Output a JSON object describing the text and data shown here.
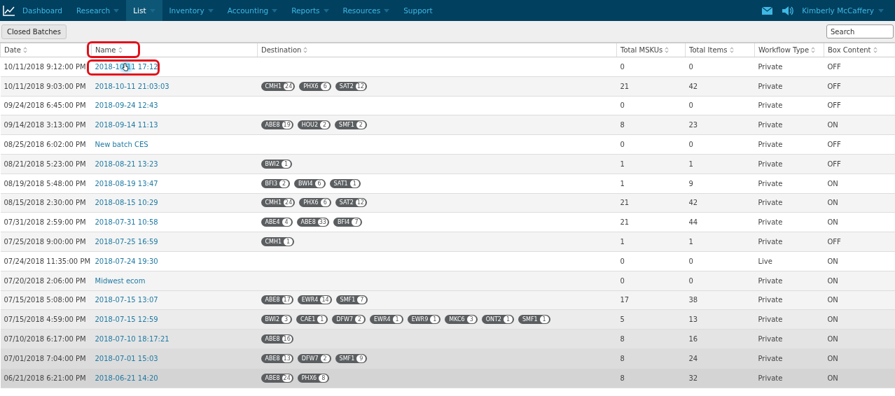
{
  "nav": {
    "items": [
      {
        "label": "Dashboard",
        "selected": false,
        "dropdown": false
      },
      {
        "label": "Research",
        "selected": false,
        "dropdown": true
      },
      {
        "label": "List",
        "selected": true,
        "dropdown": true
      },
      {
        "label": "Inventory",
        "selected": false,
        "dropdown": true
      },
      {
        "label": "Accounting",
        "selected": false,
        "dropdown": true
      },
      {
        "label": "Reports",
        "selected": false,
        "dropdown": true
      },
      {
        "label": "Resources",
        "selected": false,
        "dropdown": true
      },
      {
        "label": "Support",
        "selected": false,
        "dropdown": false
      }
    ],
    "user": "Kimberly McCaffery"
  },
  "toolbar": {
    "button": "Closed Batches",
    "search": {
      "placeholder": "Search"
    }
  },
  "table": {
    "columns": [
      "Date",
      "Name",
      "Destination",
      "Total MSKUs",
      "Total Items",
      "Workflow Type",
      "Box Content"
    ],
    "rows": [
      {
        "date": "10/11/2018 9:12:00 PM",
        "name": "2018-10-11 17:12",
        "destinations": [],
        "mskus": "0",
        "items": "0",
        "workflow": "Private",
        "box": "OFF"
      },
      {
        "date": "10/11/2018 9:03:00 PM",
        "name": "2018-10-11 21:03:03",
        "destinations": [
          {
            "code": "CMH1",
            "count": "24"
          },
          {
            "code": "PHX6",
            "count": "6"
          },
          {
            "code": "SAT2",
            "count": "12"
          }
        ],
        "mskus": "21",
        "items": "42",
        "workflow": "Private",
        "box": "OFF"
      },
      {
        "date": "09/24/2018 6:45:00 PM",
        "name": "2018-09-24 12:43",
        "destinations": [],
        "mskus": "0",
        "items": "0",
        "workflow": "Private",
        "box": "OFF"
      },
      {
        "date": "09/14/2018 3:13:00 PM",
        "name": "2018-09-14 11:13",
        "destinations": [
          {
            "code": "ABE8",
            "count": "19"
          },
          {
            "code": "HOU2",
            "count": "2"
          },
          {
            "code": "SMF1",
            "count": "2"
          }
        ],
        "mskus": "8",
        "items": "23",
        "workflow": "Private",
        "box": "ON"
      },
      {
        "date": "08/25/2018 6:02:00 PM",
        "name": "New batch CES",
        "destinations": [],
        "mskus": "0",
        "items": "0",
        "workflow": "Private",
        "box": "OFF"
      },
      {
        "date": "08/21/2018 5:23:00 PM",
        "name": "2018-08-21 13:23",
        "destinations": [
          {
            "code": "BWI2",
            "count": "1"
          }
        ],
        "mskus": "1",
        "items": "1",
        "workflow": "Private",
        "box": "OFF"
      },
      {
        "date": "08/19/2018 5:48:00 PM",
        "name": "2018-08-19 13:47",
        "destinations": [
          {
            "code": "BFI3",
            "count": "2"
          },
          {
            "code": "BWI4",
            "count": "6"
          },
          {
            "code": "SAT1",
            "count": "1"
          }
        ],
        "mskus": "1",
        "items": "9",
        "workflow": "Private",
        "box": "ON"
      },
      {
        "date": "08/15/2018 2:30:00 PM",
        "name": "2018-08-15 10:29",
        "destinations": [
          {
            "code": "CMH1",
            "count": "24"
          },
          {
            "code": "PHX6",
            "count": "6"
          },
          {
            "code": "SAT2",
            "count": "12"
          }
        ],
        "mskus": "21",
        "items": "42",
        "workflow": "Private",
        "box": "ON"
      },
      {
        "date": "07/31/2018 2:59:00 PM",
        "name": "2018-07-31 10:58",
        "destinations": [
          {
            "code": "ABE4",
            "count": "4"
          },
          {
            "code": "ABE8",
            "count": "33"
          },
          {
            "code": "BFI4",
            "count": "7"
          }
        ],
        "mskus": "21",
        "items": "44",
        "workflow": "Private",
        "box": "ON"
      },
      {
        "date": "07/25/2018 9:00:00 PM",
        "name": "2018-07-25 16:59",
        "destinations": [
          {
            "code": "CMH1",
            "count": "1"
          }
        ],
        "mskus": "1",
        "items": "1",
        "workflow": "Private",
        "box": "OFF"
      },
      {
        "date": "07/24/2018 11:35:00 PM",
        "name": "2018-07-24 19:30",
        "destinations": [],
        "mskus": "0",
        "items": "0",
        "workflow": "Live",
        "box": "ON"
      },
      {
        "date": "07/20/2018 2:06:00 PM",
        "name": "Midwest ecom",
        "destinations": [],
        "mskus": "0",
        "items": "0",
        "workflow": "Private",
        "box": "ON"
      },
      {
        "date": "07/15/2018 5:08:00 PM",
        "name": "2018-07-15 13:07",
        "destinations": [
          {
            "code": "ABE8",
            "count": "17"
          },
          {
            "code": "EWR4",
            "count": "14"
          },
          {
            "code": "SMF1",
            "count": "7"
          }
        ],
        "mskus": "17",
        "items": "38",
        "workflow": "Private",
        "box": "ON"
      },
      {
        "date": "07/15/2018 4:59:00 PM",
        "name": "2018-07-15 12:59",
        "destinations": [
          {
            "code": "BWI2",
            "count": "3"
          },
          {
            "code": "CAE1",
            "count": "1"
          },
          {
            "code": "DFW7",
            "count": "2"
          },
          {
            "code": "EWR4",
            "count": "1"
          },
          {
            "code": "EWR9",
            "count": "1"
          },
          {
            "code": "MKC6",
            "count": "3"
          },
          {
            "code": "ONT2",
            "count": "1"
          },
          {
            "code": "SMF1",
            "count": "1"
          }
        ],
        "mskus": "5",
        "items": "13",
        "workflow": "Private",
        "box": "ON"
      },
      {
        "date": "07/10/2018 6:17:00 PM",
        "name": "2018-07-10 18:17:21",
        "destinations": [
          {
            "code": "ABE8",
            "count": "16"
          }
        ],
        "mskus": "8",
        "items": "16",
        "workflow": "Private",
        "box": "ON"
      },
      {
        "date": "07/01/2018 7:04:00 PM",
        "name": "2018-07-01 15:03",
        "destinations": [
          {
            "code": "ABE8",
            "count": "13"
          },
          {
            "code": "DFW7",
            "count": "2"
          },
          {
            "code": "SMF1",
            "count": "9"
          }
        ],
        "mskus": "8",
        "items": "24",
        "workflow": "Private",
        "box": "ON"
      },
      {
        "date": "06/21/2018 6:21:00 PM",
        "name": "2018-06-21 14:20",
        "destinations": [
          {
            "code": "ABE8",
            "count": "24"
          },
          {
            "code": "PHX6",
            "count": "8"
          }
        ],
        "mskus": "8",
        "items": "32",
        "workflow": "Private",
        "box": "ON"
      }
    ]
  }
}
